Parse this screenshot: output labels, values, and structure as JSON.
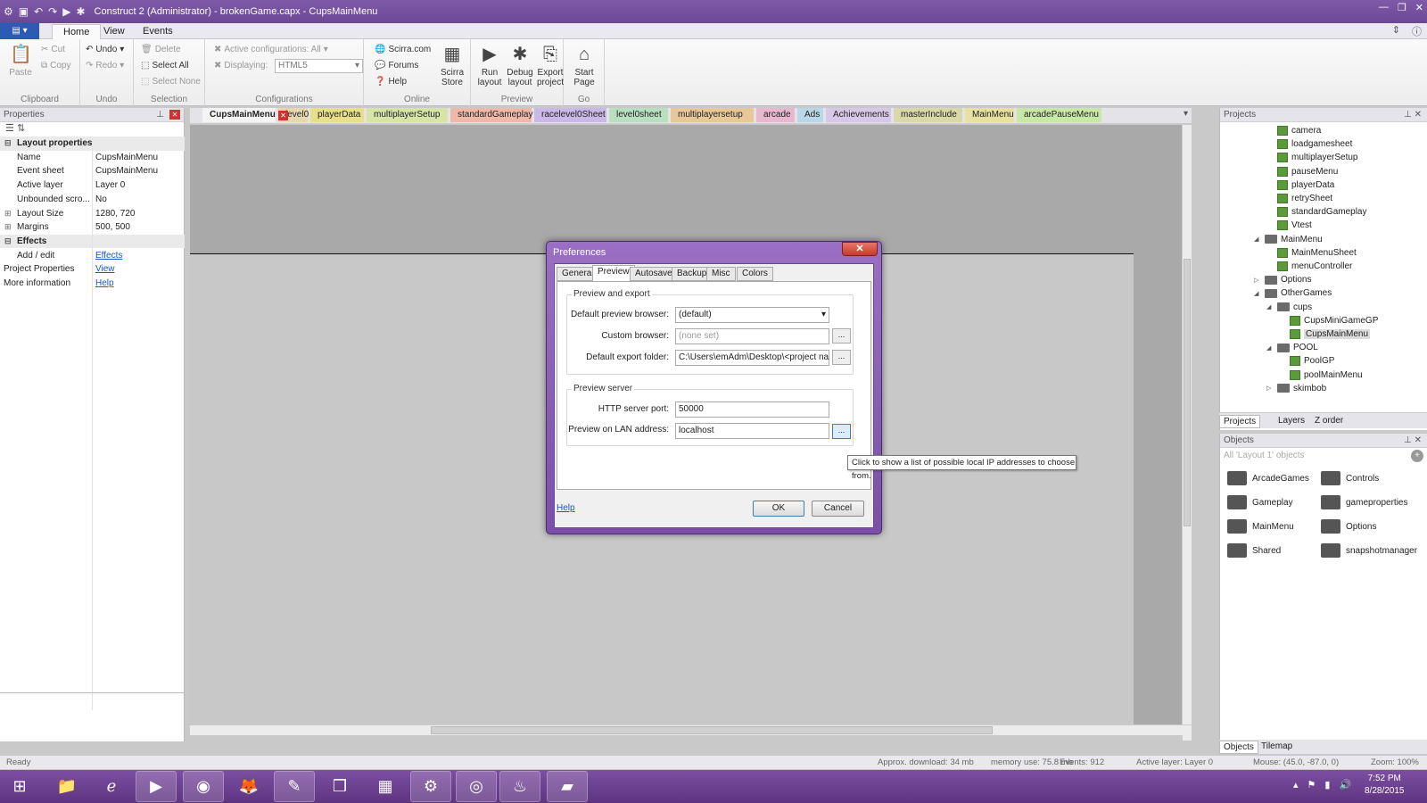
{
  "window": {
    "title": "Construct 2 (Administrator) - brokenGame.capx - CupsMainMenu"
  },
  "ribbon": {
    "tabs": [
      "Home",
      "View",
      "Events"
    ],
    "clipboard": {
      "paste": "Paste",
      "cut": "Cut",
      "copy": "Copy",
      "label": "Clipboard"
    },
    "undo": {
      "undo": "Undo",
      "redo": "Redo",
      "label": "Undo"
    },
    "selection": {
      "delete": "Delete",
      "select_all": "Select All",
      "select_none": "Select None",
      "label": "Selection"
    },
    "configurations": {
      "active": "Active configurations: All",
      "displaying": "Displaying:",
      "display_value": "HTML5",
      "label": "Configurations"
    },
    "online": {
      "scirra": "Scirra.com",
      "forums": "Forums",
      "help": "Help",
      "store": "Scirra Store",
      "label": "Online"
    },
    "preview": {
      "run": "Run layout",
      "debug": "Debug layout",
      "export": "Export project",
      "label": "Preview"
    },
    "go": {
      "start": "Start Page",
      "label": "Go"
    }
  },
  "properties": {
    "header": "Properties",
    "rows": [
      {
        "k": "Layout properties",
        "v": "",
        "sec": true
      },
      {
        "k": "Name",
        "v": "CupsMainMenu"
      },
      {
        "k": "Event sheet",
        "v": "CupsMainMenu"
      },
      {
        "k": "Active layer",
        "v": "Layer 0"
      },
      {
        "k": "Unbounded scro...",
        "v": "No"
      },
      {
        "k": "Layout Size",
        "v": "1280, 720"
      },
      {
        "k": "Margins",
        "v": "500, 500"
      },
      {
        "k": "Effects",
        "v": "",
        "sec": true
      },
      {
        "k": "Add / edit",
        "v": "Effects",
        "link": true
      },
      {
        "k": "Project Properties",
        "v": "View",
        "link": true
      },
      {
        "k": "More information",
        "v": "Help",
        "link": true
      }
    ]
  },
  "doc_tabs": [
    {
      "name": "CupsMainMenu",
      "color": "#e3e3e8"
    },
    {
      "name": "level0",
      "color": "#e8d8b0"
    },
    {
      "name": "playerData",
      "color": "#e8df8a"
    },
    {
      "name": "multiplayerSetup",
      "color": "#d6e4a8"
    },
    {
      "name": "standardGameplay",
      "color": "#f0b8a8"
    },
    {
      "name": "racelevel0Sheet",
      "color": "#c9b8e8"
    },
    {
      "name": "level0sheet",
      "color": "#b8e0c0"
    },
    {
      "name": "multiplayersetup",
      "color": "#e8c898"
    },
    {
      "name": "arcade",
      "color": "#e8b8d0"
    },
    {
      "name": "Ads",
      "color": "#b8d8e8"
    },
    {
      "name": "Achievements",
      "color": "#d8c8e8"
    },
    {
      "name": "masterInclude",
      "color": "#d8d8a8"
    },
    {
      "name": "MainMenu",
      "color": "#e8e0a0"
    },
    {
      "name": "arcadePauseMenu",
      "color": "#c8e8a8"
    }
  ],
  "projects": {
    "header": "Projects",
    "nodes": [
      {
        "name": "camera",
        "type": "sheet",
        "indent": 4
      },
      {
        "name": "loadgamesheet",
        "type": "sheet",
        "indent": 4
      },
      {
        "name": "multiplayerSetup",
        "type": "sheet",
        "indent": 4
      },
      {
        "name": "pauseMenu",
        "type": "sheet",
        "indent": 4
      },
      {
        "name": "playerData",
        "type": "sheet",
        "indent": 4
      },
      {
        "name": "retrySheet",
        "type": "sheet",
        "indent": 4
      },
      {
        "name": "standardGameplay",
        "type": "sheet",
        "indent": 4
      },
      {
        "name": "Vtest",
        "type": "sheet",
        "indent": 4
      },
      {
        "name": "MainMenu",
        "type": "folder",
        "indent": 3,
        "exp": "◢"
      },
      {
        "name": "MainMenuSheet",
        "type": "sheet",
        "indent": 4
      },
      {
        "name": "menuController",
        "type": "sheet",
        "indent": 4
      },
      {
        "name": "Options",
        "type": "folder",
        "indent": 3,
        "exp": "▷"
      },
      {
        "name": "OtherGames",
        "type": "folder",
        "indent": 3,
        "exp": "◢"
      },
      {
        "name": "cups",
        "type": "folder",
        "indent": 4,
        "exp": "◢"
      },
      {
        "name": "CupsMiniGameGP",
        "type": "sheet",
        "indent": 5
      },
      {
        "name": "CupsMainMenu",
        "type": "sheet",
        "indent": 5,
        "sel": true
      },
      {
        "name": "POOL",
        "type": "folder",
        "indent": 4,
        "exp": "◢"
      },
      {
        "name": "PoolGP",
        "type": "sheet",
        "indent": 5
      },
      {
        "name": "poolMainMenu",
        "type": "sheet",
        "indent": 5
      },
      {
        "name": "skimbob",
        "type": "folder",
        "indent": 4,
        "exp": "▷"
      }
    ],
    "tabs": [
      "Projects",
      "Layers",
      "Z order"
    ]
  },
  "objects": {
    "header": "Objects",
    "filter": "All 'Layout 1' objects",
    "items": [
      "ArcadeGames",
      "Controls",
      "Gameplay",
      "gameproperties",
      "MainMenu",
      "Options",
      "Shared",
      "snapshotmanager"
    ],
    "tabs": [
      "Objects",
      "Tilemap"
    ]
  },
  "dialog": {
    "title": "Preferences",
    "tabs": [
      "General",
      "Preview",
      "Autosave",
      "Backup",
      "Misc",
      "Colors"
    ],
    "group1": "Preview and export",
    "browser_label": "Default preview browser:",
    "browser_value": "(default)",
    "custom_label": "Custom browser:",
    "custom_placeholder": "(none set)",
    "export_label": "Default export folder:",
    "export_value": "C:\\Users\\emAdm\\Desktop\\<project name>",
    "group2": "Preview server",
    "port_label": "HTTP server port:",
    "port_value": "50000",
    "lan_label": "Preview on LAN address:",
    "lan_value": "localhost",
    "help": "Help",
    "ok": "OK",
    "cancel": "Cancel",
    "dots": "..."
  },
  "tooltip": "Click to show a list of possible local IP addresses to choose from.",
  "status": {
    "ready": "Ready",
    "download": "Approx. download: 34 mb",
    "memory": "memory use: 75.8 mb",
    "events": "Events: 912",
    "layer": "Active layer: Layer 0",
    "mouse": "Mouse: (45.0, -87.0, 0)",
    "zoom": "Zoom: 100%"
  },
  "clock": {
    "time": "7:52 PM",
    "date": "8/28/2015"
  }
}
